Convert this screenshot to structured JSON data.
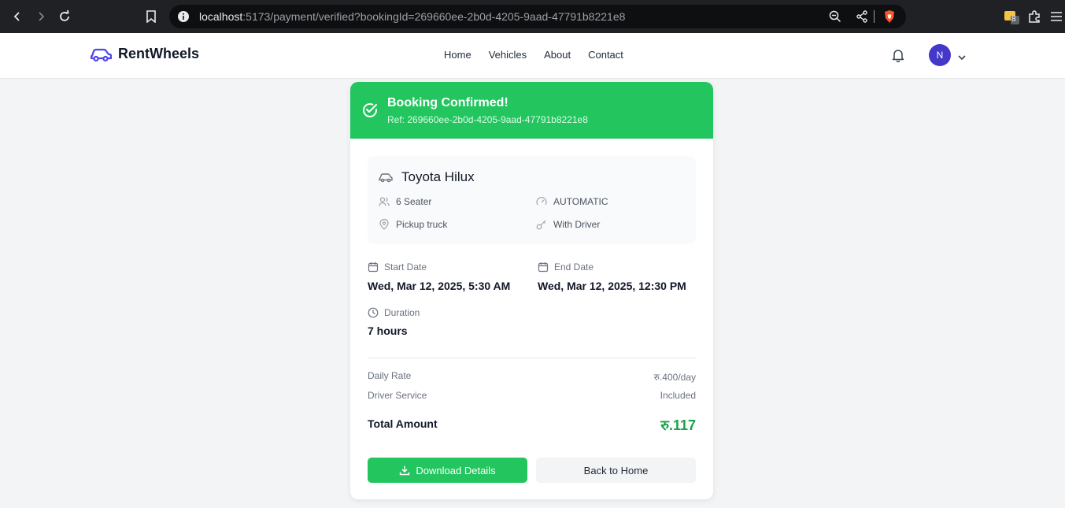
{
  "browser": {
    "url_host": "localhost",
    "url_path": ":5173/payment/verified?bookingId=269660ee-2b0d-4205-9aad-47791b8221e8",
    "extension_badge": "8"
  },
  "header": {
    "brand": "RentWheels",
    "nav": [
      "Home",
      "Vehicles",
      "About",
      "Contact"
    ],
    "avatar_initial": "N",
    "accent": "#4338ca"
  },
  "booking": {
    "status_title": "Booking Confirmed!",
    "reference": "Ref: 269660ee-2b0d-4205-9aad-47791b8221e8",
    "status_color": "#22c55e",
    "vehicle": {
      "name": "Toyota Hilux",
      "seats": "6 Seater",
      "transmission": "AUTOMATIC",
      "type": "Pickup truck",
      "driver": "With Driver"
    },
    "start_label": "Start Date",
    "start_value": "Wed, Mar 12, 2025, 5:30 AM",
    "end_label": "End Date",
    "end_value": "Wed, Mar 12, 2025, 12:30 PM",
    "duration_label": "Duration",
    "duration_value": "7 hours",
    "pricing": {
      "daily_rate_label": "Daily Rate",
      "daily_rate_value": "रु.400/day",
      "driver_label": "Driver Service",
      "driver_value": "Included",
      "total_label": "Total Amount",
      "total_value": "रु.117"
    },
    "buttons": {
      "download": "Download Details",
      "home": "Back to Home"
    }
  }
}
